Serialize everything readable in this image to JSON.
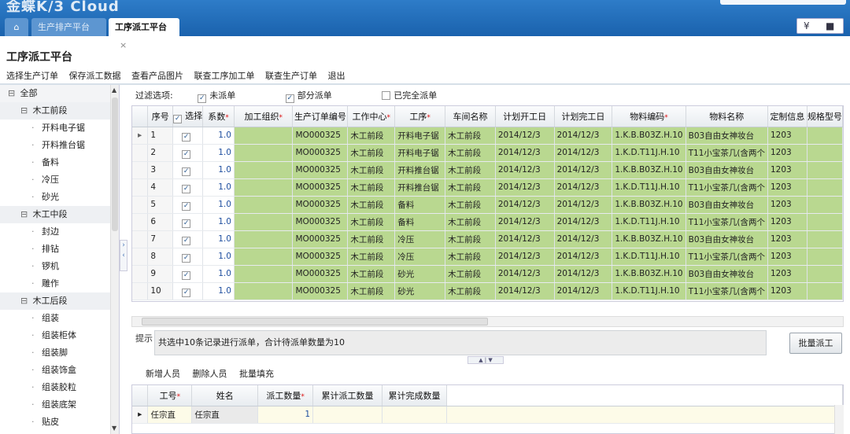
{
  "app": {
    "logo": "金蝶K/3 Cloud"
  },
  "tabs": [
    {
      "label": "生产排产平台"
    },
    {
      "label": "工序派工平台"
    }
  ],
  "tab_close": "×",
  "window_buttons": {
    "collapse": "¥",
    "menu": "■"
  },
  "page": {
    "title": "工序派工平台"
  },
  "toolbar": [
    "选择生产订单",
    "保存派工数据",
    "查看产品图片",
    "联查工序加工单",
    "联查生产订单",
    "退出"
  ],
  "tree": {
    "root": "全部",
    "groups": [
      {
        "label": "木工前段",
        "items": [
          "开料电子锯",
          "开料推台锯",
          "备料",
          "冷压",
          "砂光"
        ]
      },
      {
        "label": "木工中段",
        "items": [
          "封边",
          "排钻",
          "锣机",
          "雕作"
        ]
      },
      {
        "label": "木工后段",
        "items": [
          "组装",
          "组装柜体",
          "组装脚",
          "组装饰盒",
          "组装胶粒",
          "组装底架",
          "贴皮"
        ]
      }
    ]
  },
  "filter": {
    "label": "过滤选项:",
    "options": [
      {
        "label": "未派单",
        "checked": true
      },
      {
        "label": "部分派单",
        "checked": true
      },
      {
        "label": "已完全派单",
        "checked": false
      }
    ]
  },
  "grid": {
    "columns": [
      "序号",
      "选择",
      "系数",
      "加工组织",
      "生产订单编号",
      "工作中心",
      "工序",
      "车间名称",
      "计划开工日",
      "计划完工日",
      "物料编码",
      "物料名称",
      "定制信息",
      "规格型号"
    ],
    "required": [
      "系数",
      "加工组织",
      "工作中心",
      "工序",
      "物料编码"
    ],
    "rows": [
      {
        "seq": "1",
        "checked": true,
        "coef": "1.0",
        "org": "",
        "mo": "MO000325",
        "wc": "木工前段",
        "op": "开料电子锯",
        "ws": "木工前段",
        "start": "2014/12/3",
        "end": "2014/12/3",
        "mat": "1.K.B.B03Z.H.10",
        "name": "B03自由女神妆台",
        "custom": "1203",
        "spec": ""
      },
      {
        "seq": "2",
        "checked": true,
        "coef": "1.0",
        "org": "",
        "mo": "MO000325",
        "wc": "木工前段",
        "op": "开料电子锯",
        "ws": "木工前段",
        "start": "2014/12/3",
        "end": "2014/12/3",
        "mat": "1.K.D.T11J.H.10",
        "name": "T11小宝茶几(含两个",
        "custom": "1203",
        "spec": ""
      },
      {
        "seq": "3",
        "checked": true,
        "coef": "1.0",
        "org": "",
        "mo": "MO000325",
        "wc": "木工前段",
        "op": "开料推台锯",
        "ws": "木工前段",
        "start": "2014/12/3",
        "end": "2014/12/3",
        "mat": "1.K.B.B03Z.H.10",
        "name": "B03自由女神妆台",
        "custom": "1203",
        "spec": ""
      },
      {
        "seq": "4",
        "checked": true,
        "coef": "1.0",
        "org": "",
        "mo": "MO000325",
        "wc": "木工前段",
        "op": "开料推台锯",
        "ws": "木工前段",
        "start": "2014/12/3",
        "end": "2014/12/3",
        "mat": "1.K.D.T11J.H.10",
        "name": "T11小宝茶几(含两个",
        "custom": "1203",
        "spec": ""
      },
      {
        "seq": "5",
        "checked": true,
        "coef": "1.0",
        "org": "",
        "mo": "MO000325",
        "wc": "木工前段",
        "op": "备料",
        "ws": "木工前段",
        "start": "2014/12/3",
        "end": "2014/12/3",
        "mat": "1.K.B.B03Z.H.10",
        "name": "B03自由女神妆台",
        "custom": "1203",
        "spec": ""
      },
      {
        "seq": "6",
        "checked": true,
        "coef": "1.0",
        "org": "",
        "mo": "MO000325",
        "wc": "木工前段",
        "op": "备料",
        "ws": "木工前段",
        "start": "2014/12/3",
        "end": "2014/12/3",
        "mat": "1.K.D.T11J.H.10",
        "name": "T11小宝茶几(含两个",
        "custom": "1203",
        "spec": ""
      },
      {
        "seq": "7",
        "checked": true,
        "coef": "1.0",
        "org": "",
        "mo": "MO000325",
        "wc": "木工前段",
        "op": "冷压",
        "ws": "木工前段",
        "start": "2014/12/3",
        "end": "2014/12/3",
        "mat": "1.K.B.B03Z.H.10",
        "name": "B03自由女神妆台",
        "custom": "1203",
        "spec": ""
      },
      {
        "seq": "8",
        "checked": true,
        "coef": "1.0",
        "org": "",
        "mo": "MO000325",
        "wc": "木工前段",
        "op": "冷压",
        "ws": "木工前段",
        "start": "2014/12/3",
        "end": "2014/12/3",
        "mat": "1.K.D.T11J.H.10",
        "name": "T11小宝茶几(含两个",
        "custom": "1203",
        "spec": ""
      },
      {
        "seq": "9",
        "checked": true,
        "coef": "1.0",
        "org": "",
        "mo": "MO000325",
        "wc": "木工前段",
        "op": "砂光",
        "ws": "木工前段",
        "start": "2014/12/3",
        "end": "2014/12/3",
        "mat": "1.K.B.B03Z.H.10",
        "name": "B03自由女神妆台",
        "custom": "1203",
        "spec": ""
      },
      {
        "seq": "10",
        "checked": true,
        "coef": "1.0",
        "org": "",
        "mo": "MO000325",
        "wc": "木工前段",
        "op": "砂光",
        "ws": "木工前段",
        "start": "2014/12/3",
        "end": "2014/12/3",
        "mat": "1.K.D.T11J.H.10",
        "name": "T11小宝茶几(含两个",
        "custom": "1203",
        "spec": ""
      }
    ]
  },
  "hint": {
    "label": "提示",
    "text": "共选中10条记录进行派单，合计待派单数量为10"
  },
  "batch_button": "批量派工",
  "bottom_toolbar": [
    "新增人员",
    "删除人员",
    "批量填充"
  ],
  "grid2": {
    "columns": [
      "工号",
      "姓名",
      "派工数量",
      "累计派工数量",
      "累计完成数量"
    ],
    "required": [
      "工号",
      "派工数量"
    ],
    "rows": [
      {
        "id": "任宗直",
        "name": "任宗直",
        "qty": "1",
        "cum_dispatch": "",
        "cum_done": ""
      }
    ]
  },
  "colors": {
    "header_blue": "#1f6bb6",
    "row_green": "#b9d890",
    "edit_yellow": "#fdfbe8",
    "required_red": "#dd1111"
  }
}
